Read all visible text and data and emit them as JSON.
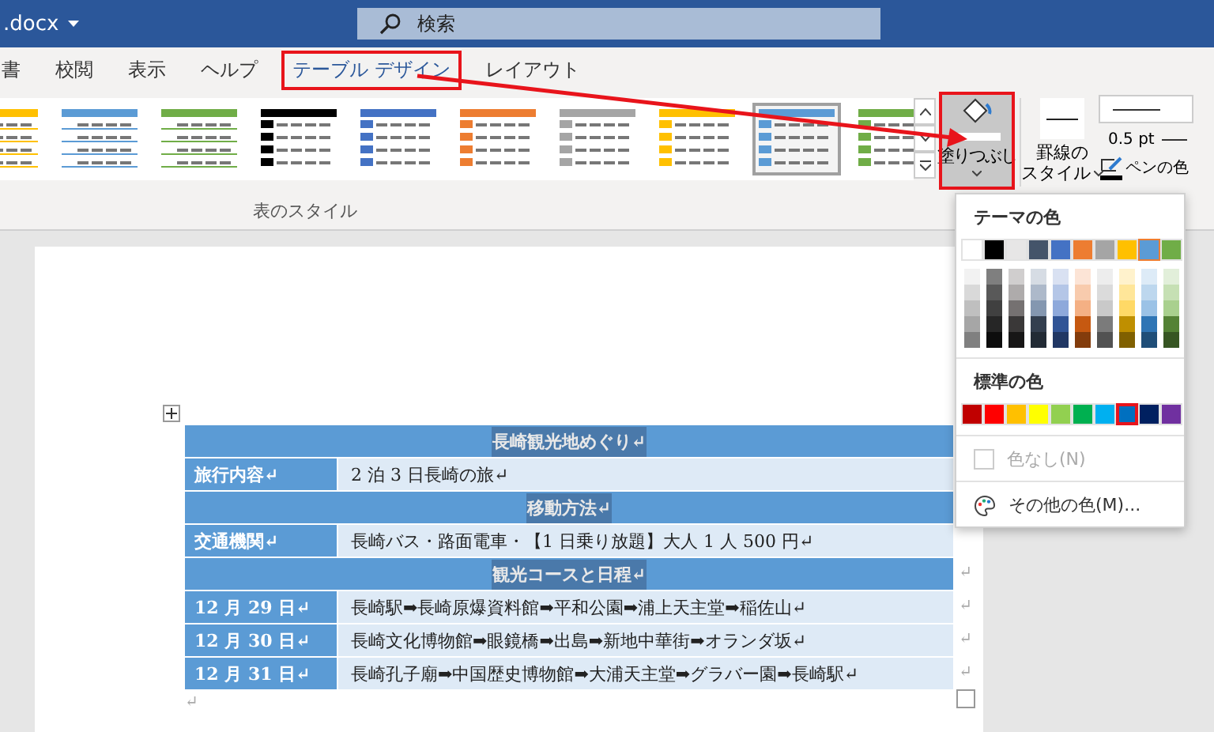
{
  "title_bar": {
    "filename": ".docx",
    "search": {
      "placeholder": "検索"
    }
  },
  "tabs": [
    {
      "label": "書",
      "selected": false,
      "callout": false
    },
    {
      "label": "校閲",
      "selected": false,
      "callout": false
    },
    {
      "label": "表示",
      "selected": false,
      "callout": false
    },
    {
      "label": "ヘルプ",
      "selected": false,
      "callout": false
    },
    {
      "label": "テーブル デザイン",
      "selected": true,
      "callout": true
    },
    {
      "label": "レイアウト",
      "selected": false,
      "callout": false
    }
  ],
  "ribbon": {
    "styles": [
      {
        "kind": "grid",
        "color": "#ffc000",
        "selected": false
      },
      {
        "kind": "grid",
        "color": "#5b9bd5",
        "selected": false
      },
      {
        "kind": "grid",
        "color": "#70ad47",
        "selected": false
      },
      {
        "kind": "column",
        "color": "#000000",
        "selected": false
      },
      {
        "kind": "column",
        "color": "#4472c4",
        "selected": false
      },
      {
        "kind": "column",
        "color": "#ed7d31",
        "selected": false
      },
      {
        "kind": "column",
        "color": "#a5a5a5",
        "selected": false
      },
      {
        "kind": "column",
        "color": "#ffc000",
        "selected": false
      },
      {
        "kind": "column",
        "color": "#5b9bd5",
        "selected": true
      },
      {
        "kind": "column",
        "color": "#70ad47",
        "selected": false
      }
    ],
    "group_label": "表のスタイル",
    "shading_button": {
      "label": "塗りつぶし",
      "callout": true
    },
    "border_styles": [
      "罫線の",
      "スタイル"
    ],
    "pen_weight": "0.5 pt",
    "pen_color": "ペンの色"
  },
  "document": {
    "rows": [
      {
        "kind": "header",
        "text": "長崎観光地めぐり↵"
      },
      {
        "kind": "item",
        "label": "旅行内容↵",
        "value": "2 泊 3 日長崎の旅↵"
      },
      {
        "kind": "header",
        "text": "移動方法↵"
      },
      {
        "kind": "item",
        "label": "交通機関↵",
        "value": "長崎バス・路面電車・【1 日乗り放題】大人 1 人 500 円↵"
      },
      {
        "kind": "header",
        "text": "観光コースと日程↵",
        "end_mark": "↵"
      },
      {
        "kind": "item",
        "label": "12 月 29 日↵",
        "value": "長崎駅➡長崎原爆資料館➡平和公園➡浦上天主堂➡稲佐山↵",
        "end_mark": "↵"
      },
      {
        "kind": "item",
        "label": "12 月 30 日↵",
        "value": "長崎文化博物館➡眼鏡橋➡出島➡新地中華街➡オランダ坂↵",
        "end_mark": "↵"
      },
      {
        "kind": "item",
        "label": "12 月 31 日↵",
        "value": "長崎孔子廟➡中国歴史博物館➡大浦天主堂➡グラバー園➡長崎駅↵",
        "end_mark": "↵"
      }
    ],
    "paragraph_mark": "↵"
  },
  "shading_menu": {
    "theme_heading": "テーマの色",
    "theme_colors": [
      {
        "color": "#ffffff",
        "selected": false
      },
      {
        "color": "#000000",
        "selected": false
      },
      {
        "color": "#e7e6e6",
        "selected": false
      },
      {
        "color": "#44546a",
        "selected": false
      },
      {
        "color": "#4472c4",
        "selected": false
      },
      {
        "color": "#ed7d31",
        "selected": false
      },
      {
        "color": "#a5a5a5",
        "selected": false
      },
      {
        "color": "#ffc000",
        "selected": false
      },
      {
        "color": "#5b9bd5",
        "selected": true
      },
      {
        "color": "#70ad47",
        "selected": false
      }
    ],
    "shades": [
      {
        "colors": [
          {
            "color": "#f2f2f2"
          },
          {
            "color": "#d9d9d9"
          },
          {
            "color": "#bfbfbf"
          },
          {
            "color": "#a6a6a6"
          },
          {
            "color": "#808080"
          }
        ]
      },
      {
        "colors": [
          {
            "color": "#7f7f7f"
          },
          {
            "color": "#595959"
          },
          {
            "color": "#404040"
          },
          {
            "color": "#262626"
          },
          {
            "color": "#0d0d0d"
          }
        ]
      },
      {
        "colors": [
          {
            "color": "#d0cece"
          },
          {
            "color": "#aeabab"
          },
          {
            "color": "#757171"
          },
          {
            "color": "#3a3838"
          },
          {
            "color": "#171616"
          }
        ]
      },
      {
        "colors": [
          {
            "color": "#d6dce4"
          },
          {
            "color": "#adb9ca"
          },
          {
            "color": "#8497b0"
          },
          {
            "color": "#333f4f"
          },
          {
            "color": "#222b35"
          }
        ]
      },
      {
        "colors": [
          {
            "color": "#d9e1f2"
          },
          {
            "color": "#b4c6e7"
          },
          {
            "color": "#8ea9db"
          },
          {
            "color": "#305496"
          },
          {
            "color": "#203764"
          }
        ]
      },
      {
        "colors": [
          {
            "color": "#fce4d6"
          },
          {
            "color": "#f8cbad"
          },
          {
            "color": "#f4b084"
          },
          {
            "color": "#c65911"
          },
          {
            "color": "#833c0c"
          }
        ]
      },
      {
        "colors": [
          {
            "color": "#ededed"
          },
          {
            "color": "#dbdbdb"
          },
          {
            "color": "#c9c9c9"
          },
          {
            "color": "#7b7b7b"
          },
          {
            "color": "#525252"
          }
        ]
      },
      {
        "colors": [
          {
            "color": "#fff2cc"
          },
          {
            "color": "#ffe699"
          },
          {
            "color": "#ffd966"
          },
          {
            "color": "#bf8f00"
          },
          {
            "color": "#806000"
          }
        ]
      },
      {
        "colors": [
          {
            "color": "#ddebf7"
          },
          {
            "color": "#bdd7ee"
          },
          {
            "color": "#9bc2e6"
          },
          {
            "color": "#2f75b5"
          },
          {
            "color": "#1f4e78"
          }
        ]
      },
      {
        "colors": [
          {
            "color": "#e2efda"
          },
          {
            "color": "#c6e0b4"
          },
          {
            "color": "#a9d08e"
          },
          {
            "color": "#548235"
          },
          {
            "color": "#375623"
          }
        ]
      }
    ],
    "standard_heading": "標準の色",
    "standard_colors": [
      {
        "color": "#c00000",
        "selected": false
      },
      {
        "color": "#ff0000",
        "selected": false
      },
      {
        "color": "#ffc000",
        "selected": false
      },
      {
        "color": "#ffff00",
        "selected": false
      },
      {
        "color": "#92d050",
        "selected": false
      },
      {
        "color": "#00b050",
        "selected": false
      },
      {
        "color": "#00b0f0",
        "selected": false
      },
      {
        "color": "#0070c0",
        "selected": true
      },
      {
        "color": "#002060",
        "selected": false
      },
      {
        "color": "#7030a0",
        "selected": false
      }
    ],
    "no_color": {
      "label": "色なし(N)",
      "disabled": true
    },
    "more_colors": "その他の色(M)..."
  }
}
